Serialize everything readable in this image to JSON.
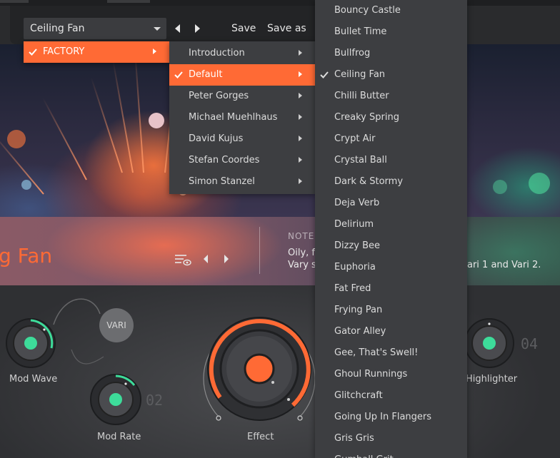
{
  "toolbar": {
    "preset_selected": "Ceiling Fan",
    "save_label": "Save",
    "save_as_label": "Save as"
  },
  "info": {
    "preset_name": "g Fan",
    "notes_label": "NOTES",
    "notes_line1": "Oily, fa",
    "notes_line2": "Vary sh",
    "notes_line2_tail": "ari 1 and Vari 2."
  },
  "controls": {
    "mod_wave": "Mod Wave",
    "mod_rate": "Mod Rate",
    "effect": "Effect",
    "highlighter": "Highlighter",
    "vari": "VARI",
    "num_mod_rate": "02",
    "num_highlighter": "04"
  },
  "menus": {
    "factory": {
      "label": "FACTORY"
    },
    "banks": [
      {
        "label": "Introduction"
      },
      {
        "label": "Default"
      },
      {
        "label": "Peter Gorges"
      },
      {
        "label": "Michael Muehlhaus"
      },
      {
        "label": "David Kujus"
      },
      {
        "label": "Stefan Coordes"
      },
      {
        "label": "Simon Stanzel"
      }
    ],
    "presets": [
      {
        "label": "Bouncy Castle"
      },
      {
        "label": "Bullet Time"
      },
      {
        "label": "Bullfrog"
      },
      {
        "label": "Ceiling Fan"
      },
      {
        "label": "Chilli Butter"
      },
      {
        "label": "Creaky Spring"
      },
      {
        "label": "Crypt Air"
      },
      {
        "label": "Crystal Ball"
      },
      {
        "label": "Dark & Stormy"
      },
      {
        "label": "Deja Verb"
      },
      {
        "label": "Delirium"
      },
      {
        "label": "Dizzy Bee"
      },
      {
        "label": "Euphoria"
      },
      {
        "label": "Fat Fred"
      },
      {
        "label": "Frying Pan"
      },
      {
        "label": "Gator Alley"
      },
      {
        "label": "Gee, That's Swell!"
      },
      {
        "label": "Ghoul Runnings"
      },
      {
        "label": "Glitchcraft"
      },
      {
        "label": "Going Up In Flangers"
      },
      {
        "label": "Gris Gris"
      },
      {
        "label": "Gumball Grit"
      }
    ]
  },
  "colors": {
    "accent": "#ff6a35",
    "knob_led": "#3ddc9a",
    "menu_bg": "#3d3e41"
  }
}
